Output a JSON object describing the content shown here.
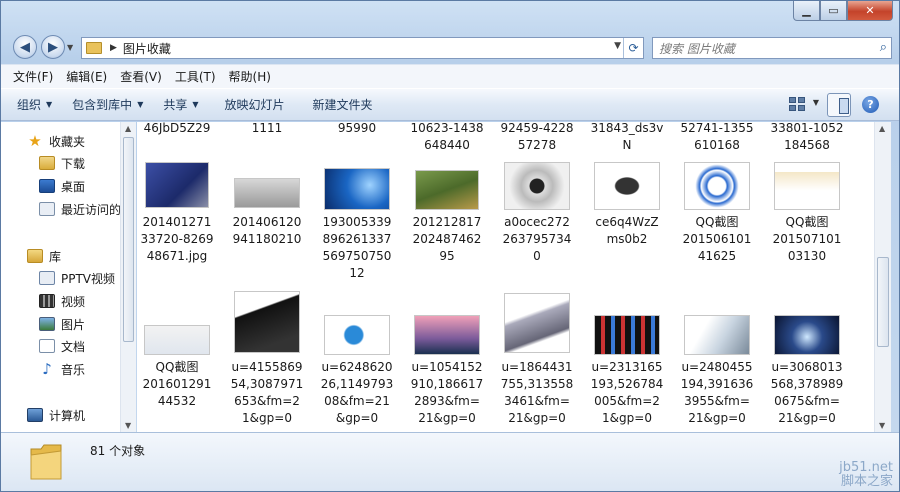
{
  "window": {
    "title_buttons": [
      "minimize",
      "maximize",
      "close"
    ]
  },
  "address": {
    "path": "图片收藏",
    "search_placeholder": "搜索 图片收藏"
  },
  "menu": [
    "文件(F)",
    "编辑(E)",
    "查看(V)",
    "工具(T)",
    "帮助(H)"
  ],
  "commands": [
    {
      "label": "组织",
      "dropdown": true
    },
    {
      "label": "包含到库中",
      "dropdown": true
    },
    {
      "label": "共享",
      "dropdown": true
    },
    {
      "label": "放映幻灯片",
      "dropdown": false
    },
    {
      "label": "新建文件夹",
      "dropdown": false
    }
  ],
  "nav": {
    "favorites": "收藏夹",
    "favorites_items": [
      "下载",
      "桌面",
      "最近访问的"
    ],
    "libraries": "库",
    "library_items": [
      "PPTV视频",
      "视频",
      "图片",
      "文档",
      "音乐"
    ],
    "computer": "计算机"
  },
  "files_row0": [
    [
      "46JbD5Z29"
    ],
    [
      "1111"
    ],
    [
      "95990"
    ],
    [
      "10623-1438",
      "648440"
    ],
    [
      "92459-4228",
      "57278"
    ],
    [
      "31843_ds3v",
      "N"
    ],
    [
      "52741-1355",
      "610168"
    ],
    [
      "33801-1052",
      "184568"
    ]
  ],
  "files_row1": [
    [
      "201401271",
      "33720-8269",
      "48671.jpg"
    ],
    [
      "201406120",
      "941180210"
    ],
    [
      "193005339",
      "896261337",
      "569750750",
      "12"
    ],
    [
      "201212817",
      "202487462",
      "95"
    ],
    [
      "a0ocec272",
      "263795734",
      "0"
    ],
    [
      "ce6q4WzZ",
      "ms0b2"
    ],
    [
      "QQ截图",
      "201506101",
      "41625"
    ],
    [
      "QQ截图",
      "201507101",
      "03130"
    ]
  ],
  "files_row2": [
    [
      "QQ截图",
      "201601291",
      "44532"
    ],
    [
      "u=4155869",
      "54,3087971",
      "653&fm=2",
      "1&gp=0"
    ],
    [
      "u=6248620",
      "26,1149793",
      "08&fm=21",
      "&gp=0"
    ],
    [
      "u=1054152",
      "910,186617",
      "2893&fm=",
      "21&gp=0"
    ],
    [
      "u=1864431",
      "755,313558",
      "3461&fm=",
      "21&gp=0"
    ],
    [
      "u=2313165",
      "193,526784",
      "005&fm=2",
      "1&gp=0"
    ],
    [
      "u=2480455",
      "194,391636",
      "3955&fm=",
      "21&gp=0"
    ],
    [
      "u=3068013",
      "568,378989",
      "0675&fm=",
      "21&gp=0"
    ]
  ],
  "status": {
    "count": "81 个对象"
  },
  "watermark": {
    "line1": "jb51.net",
    "line2": "脚本之家"
  }
}
